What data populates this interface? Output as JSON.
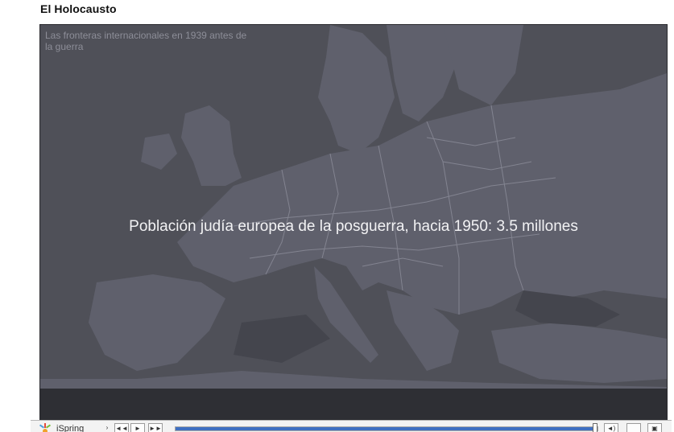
{
  "page": {
    "title": "El Holocausto"
  },
  "video": {
    "caption_top": "Las fronteras internacionales en 1939 antes de la guerra",
    "caption_main": "Población judía europea de la posguerra, hacia 1950: 3.5 millones"
  },
  "player": {
    "label": "iSpring",
    "progress": 0.99,
    "icons": [
      "ispring-logo-icon",
      "chevron-right-icon",
      "rewind-icon",
      "play-icon",
      "fast-forward-icon",
      "volume-icon",
      "blank-icon",
      "fullscreen-icon"
    ]
  },
  "colors": {
    "map_background": "#4f5058",
    "land": "#5f606c",
    "sea_dark": "#3f4048",
    "borders": "#8c8d9a",
    "progress": "#3f6fc2"
  }
}
